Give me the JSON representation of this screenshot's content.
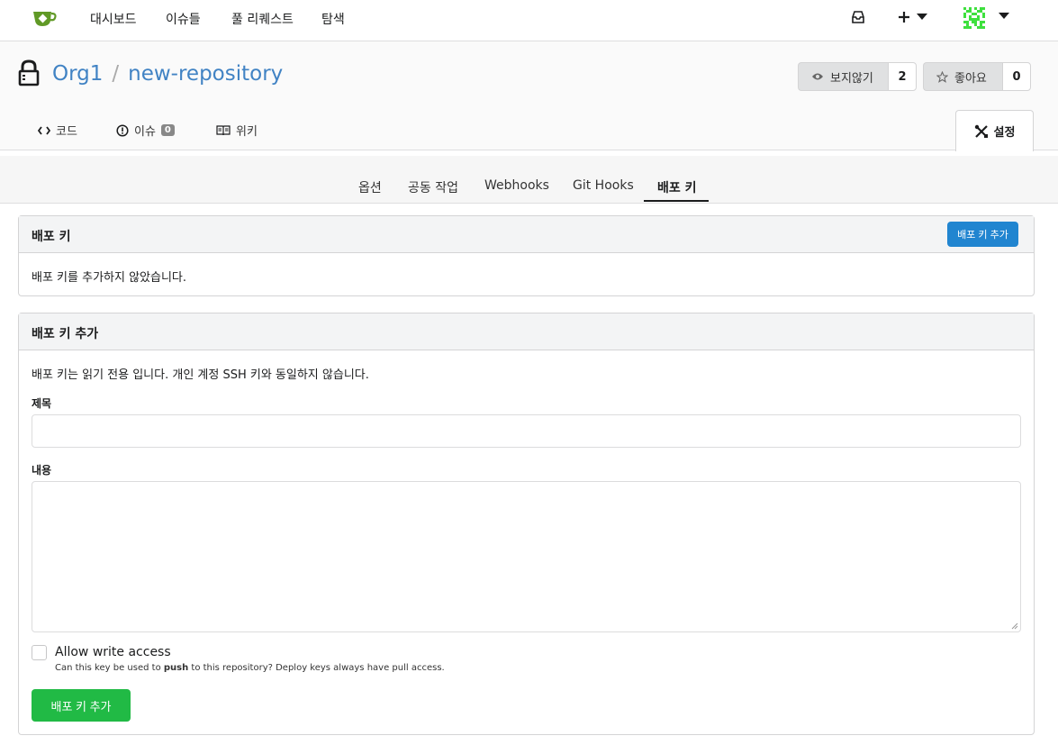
{
  "nav": {
    "links": [
      "대시보드",
      "이슈들",
      "풀 리퀘스트",
      "탐색"
    ]
  },
  "repo": {
    "owner": "Org1",
    "separator": "/",
    "name": "new-repository",
    "watch_label": "보지않기",
    "watch_count": "2",
    "star_label": "좋아요",
    "star_count": "0"
  },
  "tabs": {
    "code": "코드",
    "issues": "이슈",
    "issues_count": "0",
    "wiki": "위키",
    "settings": "설정"
  },
  "submenu": [
    "옵션",
    "공동 작업",
    "Webhooks",
    "Git Hooks",
    "배포 키"
  ],
  "deploy_keys": {
    "title": "배포 키",
    "add_button": "배포 키 추가",
    "empty_text": "배포 키를 추가하지 않았습니다."
  },
  "add_form": {
    "title": "배포 키 추가",
    "description": "배포 키는 읽기 전용 입니다. 개인 계정 SSH 키와 동일하지 않습니다.",
    "title_label": "제목",
    "content_label": "내용",
    "write_access_label": "Allow write access",
    "help_before": "Can this key be used to ",
    "help_bold": "push",
    "help_after": " to this repository? Deploy keys always have pull access.",
    "submit_button": "배포 키 추가"
  },
  "colors": {
    "link": "#4183c4",
    "primary": "#2185d0",
    "success": "#21ba45"
  }
}
